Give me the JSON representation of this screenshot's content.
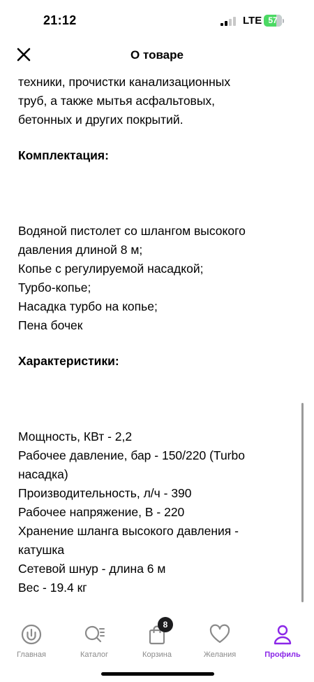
{
  "status": {
    "time": "21:12",
    "network": "LTE",
    "battery": "57"
  },
  "header": {
    "title": "О товаре",
    "close_icon": "close-icon"
  },
  "content": {
    "intro_lines": [
      "техники, прочистки канализационных",
      "труб, а также мытья асфальтовых,",
      "бетонных и других покрытий."
    ],
    "kit_title": "Комплектация:",
    "kit_items": [
      "Водяной пистолет со шлангом высокого",
      "давления длиной 8 м;",
      "Копье с регулируемой насадкой;",
      "Турбо-копье;",
      "Насадка турбо на копье;",
      "Пена бочек"
    ],
    "specs_title": "Характеристики:",
    "specs_items": [
      "Мощность, КВт - 2,2",
      "Рабочее давление, бар - 150/220 (Turbo",
      "насадка)",
      "Производительность, л/ч - 390",
      "Рабочее напряжение, В - 220",
      "Хранение шланга высокого давления -",
      "катушка",
      "Сетевой шнур - длина 6 м",
      "Вес - 19.4 кг"
    ]
  },
  "tabbar": {
    "home": "Главная",
    "catalog": "Каталог",
    "cart": "Корзина",
    "cart_badge": "8",
    "wishlist": "Желания",
    "profile": "Профиль"
  },
  "colors": {
    "accent": "#8b27e8",
    "battery": "#4cd964",
    "inactive": "#8a8a8a"
  }
}
